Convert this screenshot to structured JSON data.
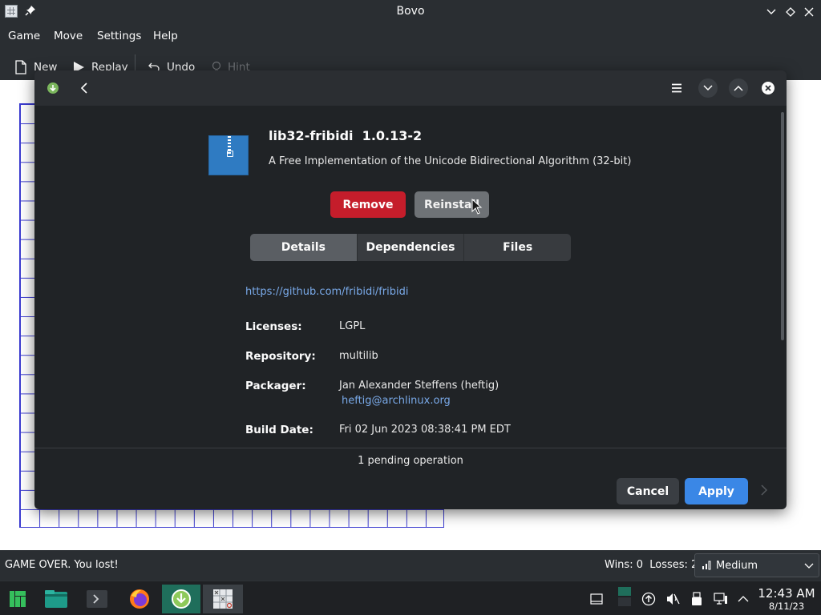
{
  "window": {
    "title": "Bovo",
    "menu": [
      "Game",
      "Move",
      "Settings",
      "Help"
    ],
    "toolbar": {
      "new_label": "New",
      "replay_label": "Replay",
      "undo_label": "Undo",
      "hint_label": "Hint"
    }
  },
  "statusbar": {
    "message": "GAME OVER. You lost!",
    "score": "Wins: 0  Losses: 2",
    "difficulty": "Medium"
  },
  "dialog": {
    "package": {
      "name": "lib32-fribidi  1.0.13-2",
      "description": "A Free Implementation of the Unicode Bidirectional Algorithm (32-bit)"
    },
    "actions": {
      "remove_label": "Remove",
      "reinstall_label": "Reinstall"
    },
    "tabs": [
      {
        "label": "Details",
        "active": true
      },
      {
        "label": "Dependencies",
        "active": false
      },
      {
        "label": "Files",
        "active": false
      }
    ],
    "details": {
      "url": "https://github.com/fribidi/fribidi",
      "licenses_label": "Licenses:",
      "licenses": "LGPL",
      "repository_label": "Repository:",
      "repository": "multilib",
      "packager_label": "Packager:",
      "packager": "Jan Alexander Steffens (heftig)",
      "packager_email": "heftig@archlinux.org",
      "build_date_label": "Build Date:",
      "build_date": "Fri 02 Jun 2023 08:38:41 PM EDT"
    },
    "footer": {
      "pending": "1 pending operation",
      "cancel_label": "Cancel",
      "apply_label": "Apply"
    }
  },
  "taskbar": {
    "time": "12:43 AM",
    "date": "8/11/23"
  },
  "colors": {
    "remove": "#c51d2b",
    "apply": "#3a87e6",
    "link": "#79a9e8",
    "board_grid": "#3a3ad0",
    "active_task": "#1f6e5b"
  }
}
